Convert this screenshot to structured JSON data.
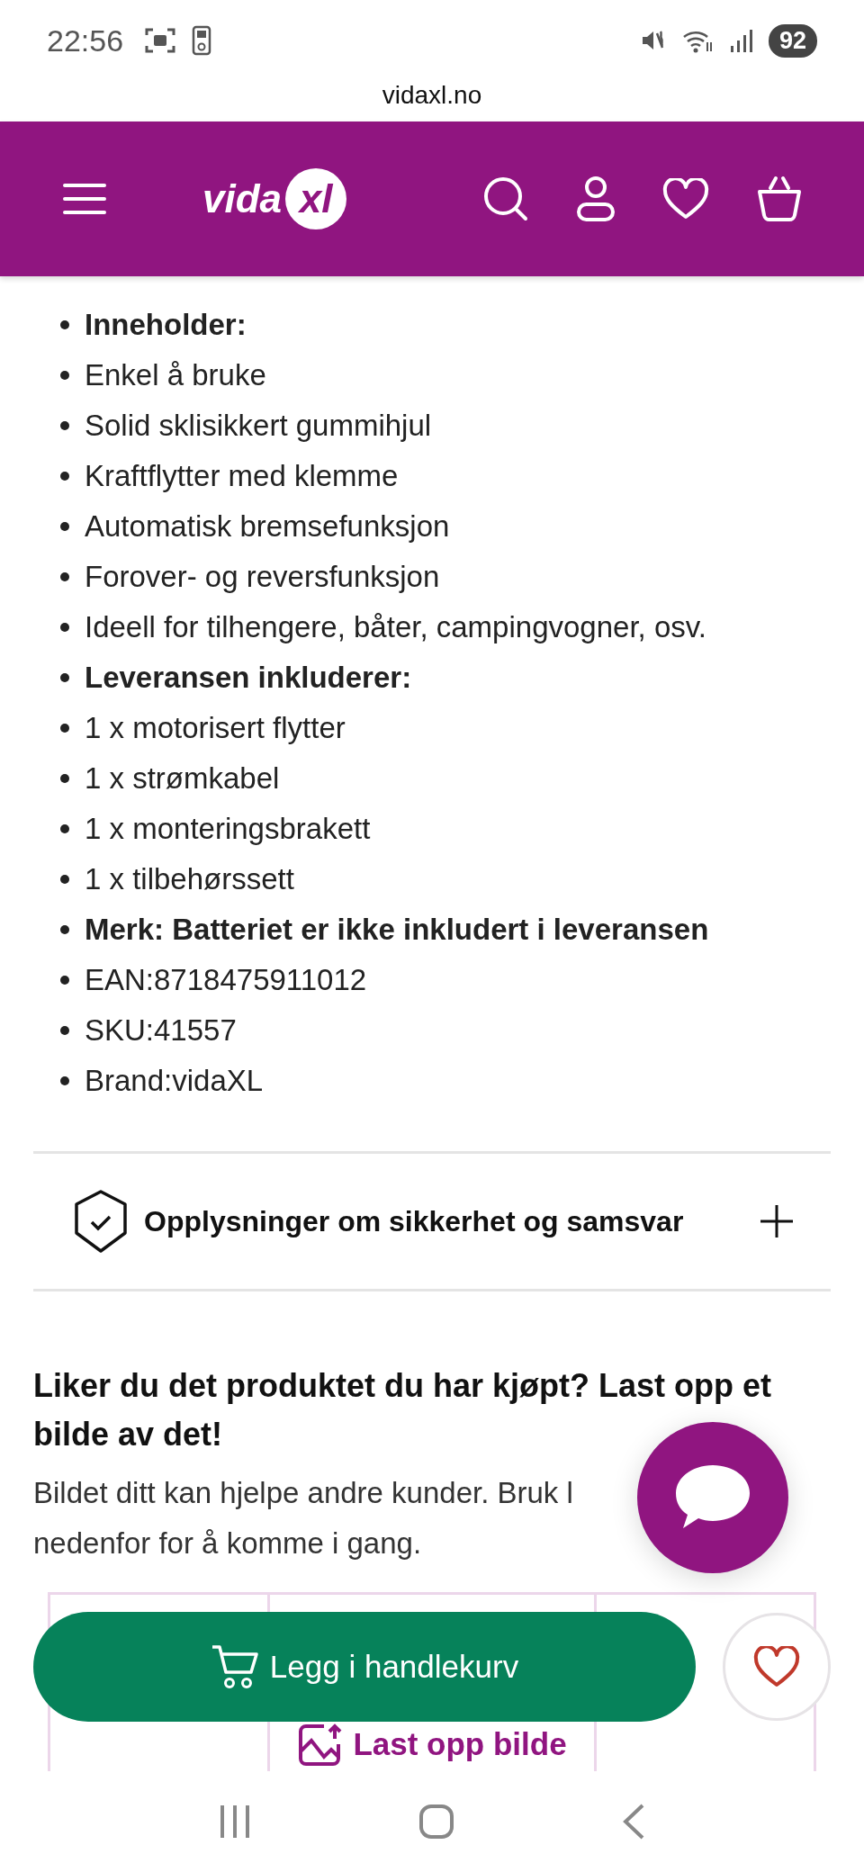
{
  "status_bar": {
    "time": "22:56",
    "battery": "92"
  },
  "address_bar": {
    "url": "vidaxl.no"
  },
  "header": {
    "logo_word": "vida",
    "logo_mark": "xl"
  },
  "specs": [
    {
      "text": "Inneholder:",
      "bold": true
    },
    {
      "text": "Enkel å bruke",
      "bold": false
    },
    {
      "text": "Solid sklisikkert gummihjul",
      "bold": false
    },
    {
      "text": "Kraftflytter med klemme",
      "bold": false
    },
    {
      "text": "Automatisk bremsefunksjon",
      "bold": false
    },
    {
      "text": "Forover- og reversfunksjon",
      "bold": false
    },
    {
      "text": "Ideell for tilhengere, båter, campingvogner, osv.",
      "bold": false
    },
    {
      "text": "Leveransen inkluderer:",
      "bold": true
    },
    {
      "text": "1 x motorisert flytter",
      "bold": false
    },
    {
      "text": "1 x strømkabel",
      "bold": false
    },
    {
      "text": "1 x monteringsbrakett",
      "bold": false
    },
    {
      "text": "1 x tilbehørssett",
      "bold": false
    },
    {
      "text": "Merk: Batteriet er ikke inkludert i leveransen",
      "bold": true
    },
    {
      "text": "EAN:8718475911012",
      "bold": false
    },
    {
      "text": "SKU:41557",
      "bold": false
    },
    {
      "text": "Brand:vidaXL",
      "bold": false
    }
  ],
  "accordion": {
    "title": "Opplysninger om sikkerhet og samsvar",
    "expanded": false
  },
  "upload_section": {
    "heading": "Liker du det produktet du har kjøpt? Last opp et bilde av det!",
    "text_line_1": "Bildet ditt kan hjelpe andre kunder. Bruk l",
    "text_line_2": "nedenfor for å komme i gang.",
    "button": "Last opp bilde"
  },
  "sticky_bar": {
    "add_to_cart": "Legg i handlekurv",
    "wishlisted": false
  }
}
